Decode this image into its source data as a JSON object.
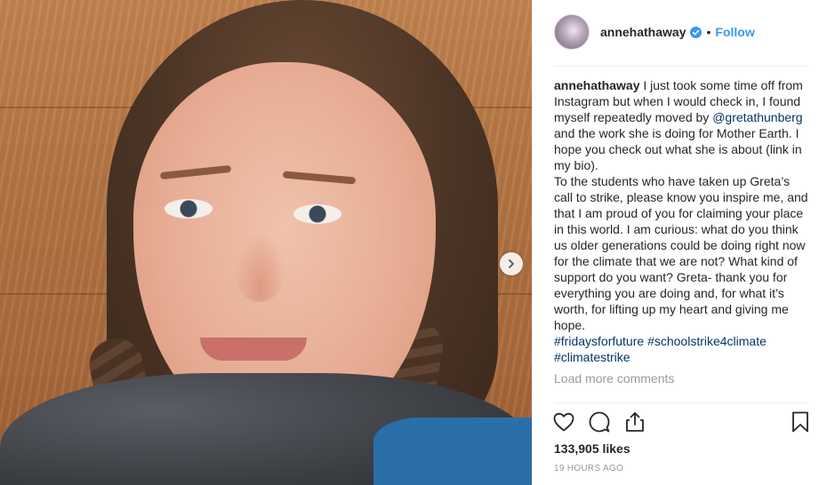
{
  "post": {
    "username": "annehathaway",
    "separator": "•",
    "follow_label": "Follow",
    "caption": {
      "author": "annehathaway",
      "part1": " I just took some time off from Instagram but when I would check in, I found myself repeatedly moved by ",
      "mention": "@gretathunberg",
      "part2": " and the work she is doing for Mother Earth. I hope you check out what she is about (link in my bio).",
      "paragraph2": "To the students who have taken up Greta’s call to strike, please know you inspire me, and that I am proud of you for claiming your place in this world. I am curious: what do you think us older generations could be doing right now for the climate that we are not? What kind of support do you want? Greta- thank you for everything you are doing and, for what it’s worth, for lifting up my heart and giving me hope.",
      "hashtags": [
        {
          "text": "#fridaysforfuture"
        },
        {
          "text": "#schoolstrike4climate"
        },
        {
          "text": "#climatestrike"
        }
      ]
    },
    "load_more_label": "Load more comments",
    "likes": "133,905 likes",
    "time_ago": "19 HOURS AGO"
  },
  "icons": {
    "verified": "verified-badge-icon",
    "next": "chevron-right-icon",
    "like": "heart-icon",
    "comment": "comment-bubble-icon",
    "share": "share-icon",
    "save": "bookmark-icon"
  },
  "colors": {
    "accent": "#3897f0",
    "link": "#003569",
    "muted": "#999999",
    "text": "#262626"
  }
}
